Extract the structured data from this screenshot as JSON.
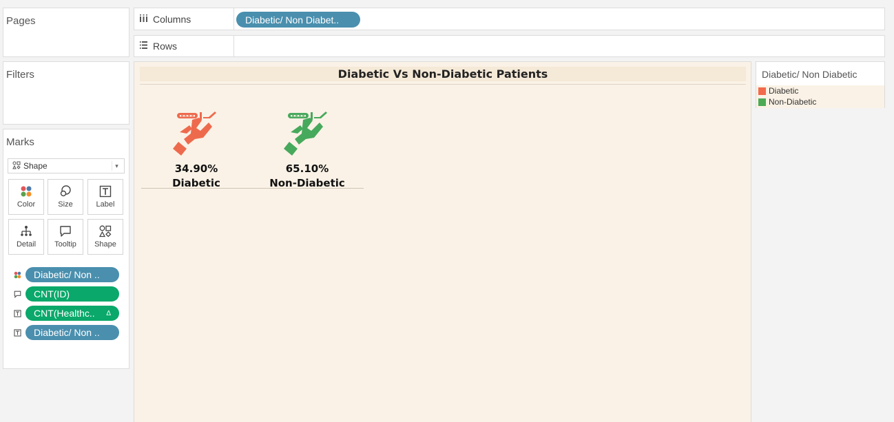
{
  "panels": {
    "pages": "Pages",
    "filters": "Filters",
    "marks": "Marks"
  },
  "marks_card": {
    "mark_type": "Shape",
    "buttons": [
      {
        "label": "Color",
        "icon": "color-icon"
      },
      {
        "label": "Size",
        "icon": "size-icon"
      },
      {
        "label": "Label",
        "icon": "label-icon"
      },
      {
        "label": "Detail",
        "icon": "detail-icon"
      },
      {
        "label": "Tooltip",
        "icon": "tooltip-icon"
      },
      {
        "label": "Shape",
        "icon": "shape-icon"
      }
    ],
    "fields": [
      {
        "label": "Diabetic/ Non ..",
        "encoding": "color"
      },
      {
        "label": "CNT(ID)",
        "encoding": "tooltip"
      },
      {
        "label": "CNT(Healthc..",
        "encoding": "label",
        "delta": "Δ"
      },
      {
        "label": "Diabetic/ Non ..",
        "encoding": "label"
      }
    ]
  },
  "shelves": {
    "columns_label": "Columns",
    "columns_pill": "Diabetic/ Non Diabet..",
    "rows_label": "Rows"
  },
  "view": {
    "title": "Diabetic Vs Non-Diabetic Patients",
    "marks": [
      {
        "percent": "34.90%",
        "category": "Diabetic",
        "color": "#ee6a4d"
      },
      {
        "percent": "65.10%",
        "category": "Non-Diabetic",
        "color": "#47a95c"
      }
    ]
  },
  "legend": {
    "title": "Diabetic/ Non Diabetic",
    "items": [
      {
        "label": "Diabetic",
        "color": "#f26a4b"
      },
      {
        "label": "Non-Diabetic",
        "color": "#4caa56"
      }
    ]
  },
  "colors": {
    "pill_blue": "#4a8fae",
    "pill_green": "#0aa86a",
    "view_bg": "#faf2e6"
  }
}
